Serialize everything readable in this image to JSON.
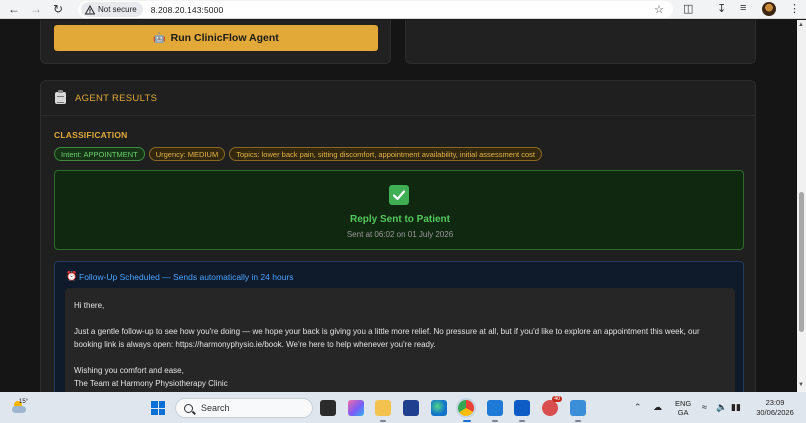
{
  "browser": {
    "security_label": "Not secure",
    "url": "8.208.20.143:5000"
  },
  "agent": {
    "run_button_label": "Run ClinicFlow Agent"
  },
  "results": {
    "title": "AGENT RESULTS",
    "classification_label": "CLASSIFICATION",
    "badges": {
      "intent": "Intent: APPOINTMENT",
      "urgency": "Urgency: MEDIUM",
      "topics": "Topics: lower back pain, sitting discomfort, appointment availability, initial assessment cost"
    },
    "reply": {
      "title": "Reply Sent to Patient",
      "timestamp": "Sent at 06:02 on 01 July 2026"
    },
    "followup": {
      "title": "Follow-Up Scheduled — Sends automatically in 24 hours",
      "greeting": "Hi there,",
      "body_line1": "Just a gentle follow-up to see how you're doing — we hope your back is giving you a little more relief. No pressure at all, but if you'd like to explore an appointment this week, our",
      "body_line2": "booking link is always open: https://harmonyphysio.ie/book. We're here to help whenever you're ready.",
      "closing": "Wishing you comfort and ease,",
      "signature": "The Team at Harmony Physiotherapy Clinic"
    }
  },
  "taskbar": {
    "temperature": "15°",
    "search_placeholder": "Search",
    "language_line1": "ENG",
    "language_line2": "GA",
    "time": "23:09",
    "date": "30/06/2026",
    "notification_badge": "40"
  },
  "colors": {
    "accent": "#e0a93a",
    "success": "#53c85c",
    "link_blue": "#4aa3ff",
    "button_bg": "#e2a838"
  }
}
